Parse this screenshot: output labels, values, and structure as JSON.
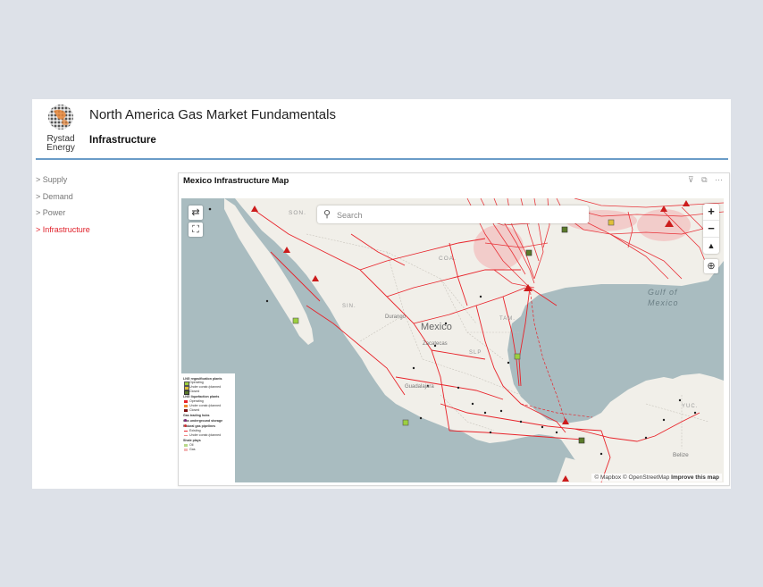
{
  "app": {
    "title": "North America Gas Market Fundamentals",
    "subtitle": "Infrastructure",
    "logo_line1": "Rystad",
    "logo_line2": "Energy"
  },
  "sidebar": {
    "items": [
      {
        "label": "> Supply",
        "active": false
      },
      {
        "label": "> Demand",
        "active": false
      },
      {
        "label": "> Power",
        "active": false
      },
      {
        "label": "> Infrastructure",
        "active": true
      }
    ]
  },
  "panel": {
    "title": "Mexico Infrastructure Map",
    "tools": "⊽ ⧉ ⋯"
  },
  "map": {
    "search_placeholder": "Search",
    "labels": {
      "son": "SON.",
      "coa": "COA.",
      "mexico": "Mexico",
      "gulf1": "Gulf of",
      "gulf2": "Mexico",
      "durango": "Durango",
      "zacatecas": "Zacatecas",
      "guadalajara": "Guadalajara",
      "tam": "TAM.",
      "sin": "SIN.",
      "slp": "SLP",
      "yuc": "YUC.",
      "belize": "Belize"
    },
    "colors": {
      "water": "#a9bcc0",
      "land": "#f1efe9",
      "pipeline": "#e8232a",
      "shale": "#f3a2a2",
      "regas": "#9ccf3e"
    }
  },
  "legend": {
    "sections": [
      {
        "title": "LNG regasification plants",
        "rows": [
          "Operating",
          "Under constr./planned",
          "Closed"
        ]
      },
      {
        "title": "LNG liquefaction plants",
        "rows": [
          "Operating",
          "Under constr./planned",
          "Closed"
        ]
      },
      {
        "title": "Gas trading hubs",
        "rows": []
      },
      {
        "title": "Gas underground storage",
        "rows": []
      },
      {
        "title": "Natural gas pipelines",
        "rows": [
          "Existing",
          "Under constr./planned"
        ]
      },
      {
        "title": "Shale plays",
        "rows": [
          "Oil",
          "Gas"
        ]
      }
    ]
  },
  "attribution": {
    "text": "© Mapbox © OpenStreetMap",
    "improve": "Improve this map"
  }
}
